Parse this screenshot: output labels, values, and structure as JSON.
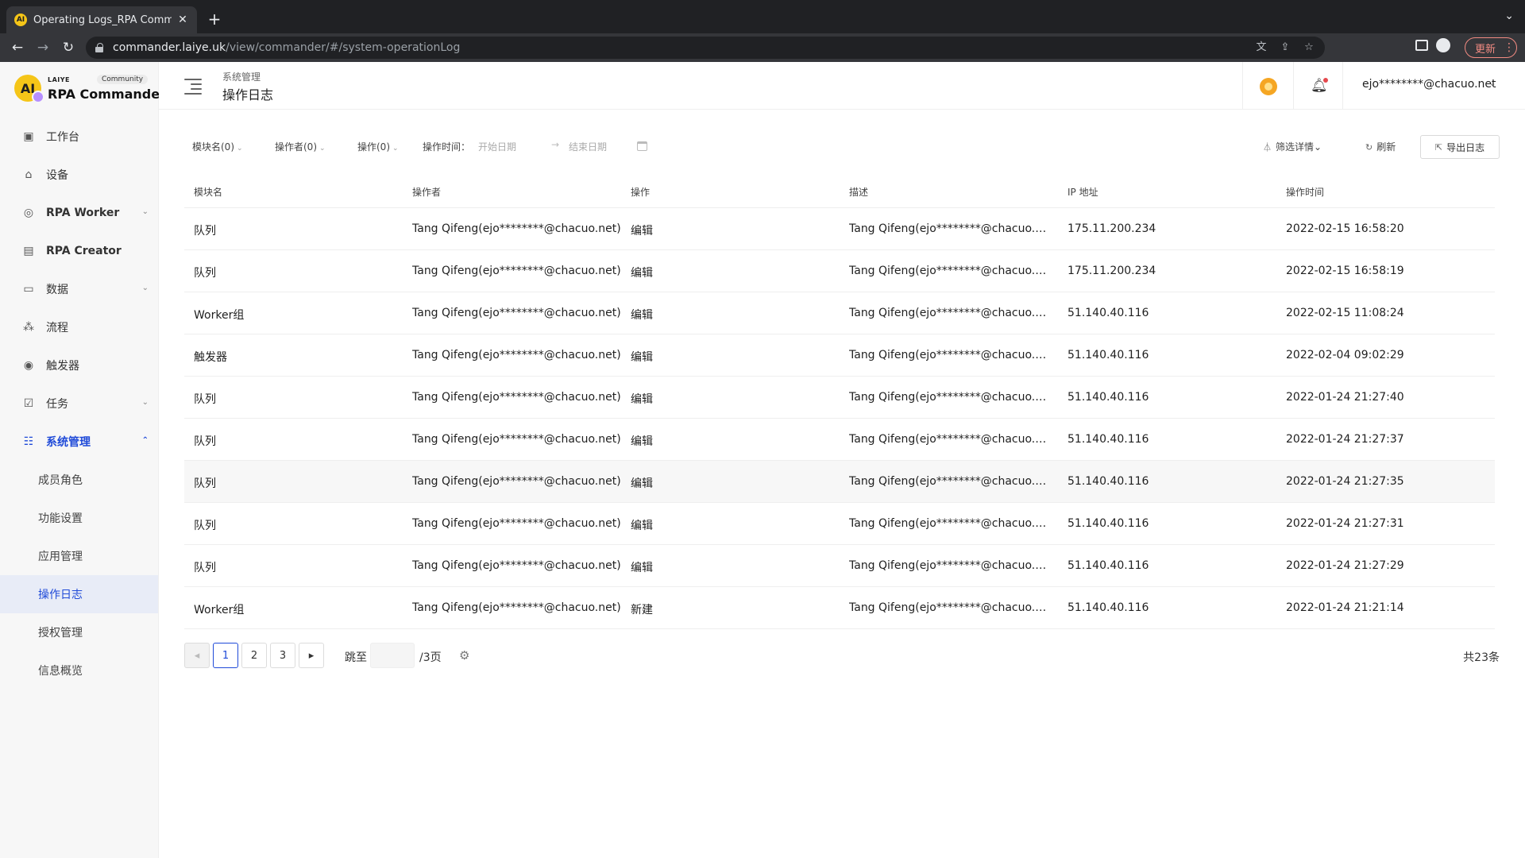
{
  "browser": {
    "tab_title": "Operating Logs_RPA Commander",
    "tab_favicon": "AI",
    "url_host": "commander.laiye.uk",
    "url_path": "/view/commander/#/system-operationLog",
    "update_label": "更新"
  },
  "sidebar": {
    "logo_brand": "LAIYE",
    "logo_edition": "Community",
    "logo_name": "RPA Commander",
    "items": [
      {
        "label": "工作台",
        "icon": "dashboard-icon",
        "expandable": false
      },
      {
        "label": "设备",
        "icon": "device-icon",
        "expandable": false
      },
      {
        "label": "RPA Worker",
        "icon": "worker-icon",
        "expandable": true
      },
      {
        "label": "RPA Creator",
        "icon": "creator-icon",
        "expandable": false
      },
      {
        "label": "数据",
        "icon": "data-icon",
        "expandable": true
      },
      {
        "label": "流程",
        "icon": "flow-icon",
        "expandable": false
      },
      {
        "label": "触发器",
        "icon": "trigger-icon",
        "expandable": false
      },
      {
        "label": "任务",
        "icon": "task-icon",
        "expandable": true
      },
      {
        "label": "系统管理",
        "icon": "system-icon",
        "expandable": true,
        "expanded": true
      }
    ],
    "sub_items": [
      {
        "label": "成员角色"
      },
      {
        "label": "功能设置"
      },
      {
        "label": "应用管理"
      },
      {
        "label": "操作日志",
        "active": true
      },
      {
        "label": "授权管理"
      },
      {
        "label": "信息概览"
      }
    ]
  },
  "header": {
    "breadcrumb_parent": "系统管理",
    "page_title": "操作日志",
    "user_email": "ejo********@chacuo.net"
  },
  "filters": {
    "module": "模块名(0)",
    "operator": "操作者(0)",
    "operation": "操作(0)",
    "time_label": "操作时间：",
    "start_placeholder": "开始日期",
    "end_placeholder": "结束日期",
    "filter_detail": "筛选详情",
    "refresh": "刷新",
    "export": "导出日志"
  },
  "table": {
    "columns": [
      "模块名",
      "操作者",
      "操作",
      "描述",
      "IP 地址",
      "操作时间"
    ],
    "rows": [
      [
        "队列",
        "Tang Qifeng(ejo********@chacuo.net)",
        "编辑",
        "Tang Qifeng(ejo********@chacuo.net...",
        "175.11.200.234",
        "2022-02-15 16:58:20"
      ],
      [
        "队列",
        "Tang Qifeng(ejo********@chacuo.net)",
        "编辑",
        "Tang Qifeng(ejo********@chacuo.net...",
        "175.11.200.234",
        "2022-02-15 16:58:19"
      ],
      [
        "Worker组",
        "Tang Qifeng(ejo********@chacuo.net)",
        "编辑",
        "Tang Qifeng(ejo********@chacuo.net...",
        "51.140.40.116",
        "2022-02-15 11:08:24"
      ],
      [
        "触发器",
        "Tang Qifeng(ejo********@chacuo.net)",
        "编辑",
        "Tang Qifeng(ejo********@chacuo.net...",
        "51.140.40.116",
        "2022-02-04 09:02:29"
      ],
      [
        "队列",
        "Tang Qifeng(ejo********@chacuo.net)",
        "编辑",
        "Tang Qifeng(ejo********@chacuo.net...",
        "51.140.40.116",
        "2022-01-24 21:27:40"
      ],
      [
        "队列",
        "Tang Qifeng(ejo********@chacuo.net)",
        "编辑",
        "Tang Qifeng(ejo********@chacuo.net...",
        "51.140.40.116",
        "2022-01-24 21:27:37"
      ],
      [
        "队列",
        "Tang Qifeng(ejo********@chacuo.net)",
        "编辑",
        "Tang Qifeng(ejo********@chacuo.net...",
        "51.140.40.116",
        "2022-01-24 21:27:35"
      ],
      [
        "队列",
        "Tang Qifeng(ejo********@chacuo.net)",
        "编辑",
        "Tang Qifeng(ejo********@chacuo.net...",
        "51.140.40.116",
        "2022-01-24 21:27:31"
      ],
      [
        "队列",
        "Tang Qifeng(ejo********@chacuo.net)",
        "编辑",
        "Tang Qifeng(ejo********@chacuo.net...",
        "51.140.40.116",
        "2022-01-24 21:27:29"
      ],
      [
        "Worker组",
        "Tang Qifeng(ejo********@chacuo.net)",
        "新建",
        "Tang Qifeng(ejo********@chacuo.net...",
        "51.140.40.116",
        "2022-01-24 21:21:14"
      ]
    ]
  },
  "pagination": {
    "pages": [
      "1",
      "2",
      "3"
    ],
    "current": "1",
    "jump_label": "跳至",
    "jump_value": "",
    "total_pages": "/3页",
    "total_count": "共23条"
  },
  "colors": {
    "accent": "#1f4ad8",
    "active_bg": "#e8ecf7",
    "logo_yellow": "#f5c518"
  }
}
